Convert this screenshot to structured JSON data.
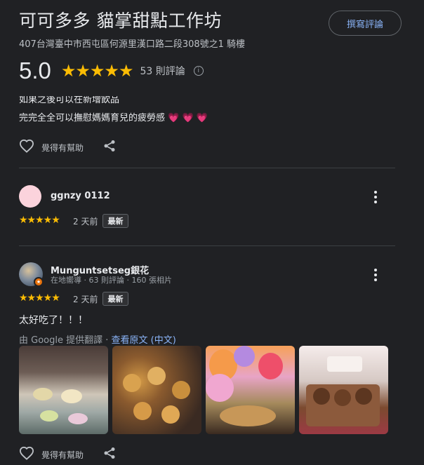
{
  "place": {
    "title": "可可多多 貓掌甜點工作坊",
    "address": "407台灣臺中市西屯區何源里漢口路二段308號之1 騎樓",
    "write_review_label": "撰寫評論",
    "rating": "5.0",
    "stars": "★★★★★",
    "review_count": "53 則評論"
  },
  "prev_review": {
    "partial_line": "如果之後可以在新增飲品",
    "last_line": "完完全全可以撫慰媽媽育兒的疲勞感",
    "hearts": "💗 💗 💗",
    "like_label": "覺得有幫助"
  },
  "reviews": [
    {
      "name": "ggnzy 0112",
      "stars": "★★★★★",
      "time": "2 天前",
      "badge": "最新",
      "avatar_color": "#fbd3dc"
    },
    {
      "name": "Munguntsetseg銀花",
      "meta": "在地嚮導 · 63 則評論 · 160 張相片",
      "stars": "★★★★★",
      "time": "2 天前",
      "badge": "最新",
      "text": "太好吃了！！！",
      "translate_prefix": "由 Google 提供翻譯 · ",
      "translate_link": "查看原文 (中文)",
      "like_label": "覺得有幫助"
    }
  ],
  "colors": {
    "background": "#202124",
    "accent_link": "#8ab4f8",
    "star": "#fbbc04"
  }
}
